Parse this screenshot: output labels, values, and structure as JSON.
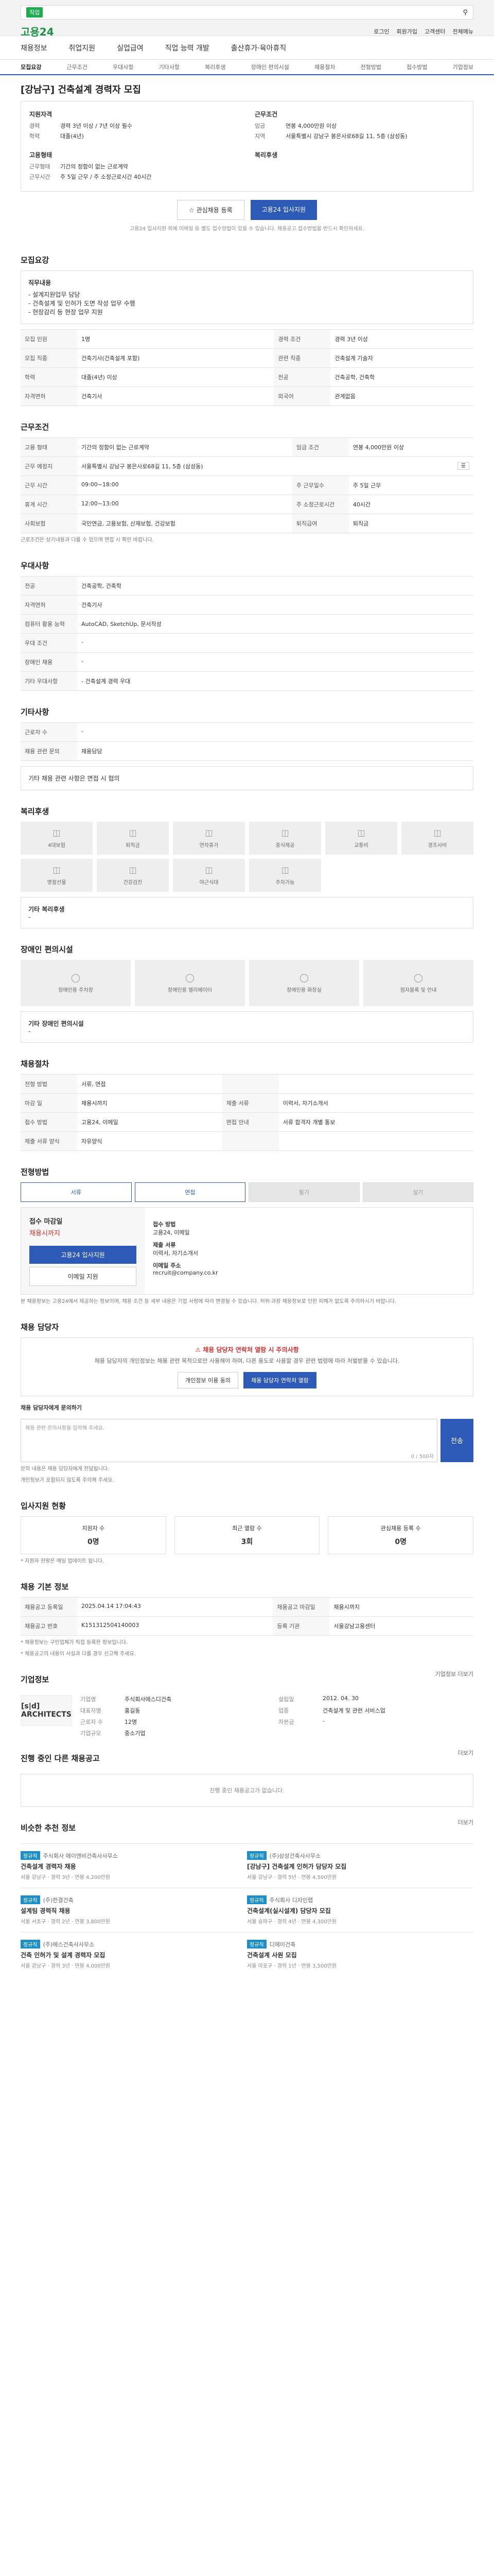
{
  "search": {
    "chip": "직업",
    "placeholder": ""
  },
  "header": {
    "logo": "고용24",
    "links": [
      "로그인",
      "회원가입",
      "고객센터",
      "전체메뉴"
    ]
  },
  "nav": {
    "items": [
      "채용정보",
      "취업지원",
      "실업급여",
      "직업 능력 개발",
      "출산휴가·육아휴직"
    ]
  },
  "tabs": [
    "모집요강",
    "근무조건",
    "우대사항",
    "기타사항",
    "복리후생",
    "장애인 편의시설",
    "채용절차",
    "전형방법",
    "접수방법",
    "기업정보"
  ],
  "job": {
    "title": "[강남구] 건축설계 경력자 모집",
    "summary": {
      "req_h": "지원자격",
      "req": [
        {
          "k": "경력",
          "v": "경력 3년 이상 / 7년 이상 필수"
        },
        {
          "k": "학력",
          "v": "대졸(4년)"
        }
      ],
      "cond_h": "근무조건",
      "cond": [
        {
          "k": "임금",
          "v": "연봉 4,000만원 이상"
        },
        {
          "k": "지역",
          "v": "서울특별시 강남구 봉은사로68길 11, 5층 (삼성동)"
        }
      ],
      "type_h": "고용형태",
      "type": [
        {
          "k": "근무형태",
          "v": "기간의 정함이 없는 근로계약"
        },
        {
          "k": "근무시간",
          "v": "주 5일 근무 / 주 소정근로시간 40시간"
        }
      ],
      "welfare_h": "복리후생",
      "welfare": []
    },
    "actions": {
      "save": "관심채용 등록",
      "apply": "고용24 입사지원"
    },
    "note": "고용24 입사지원 외에 이메일 등 별도 접수방법이 있을 수 있습니다. 채용공고 접수방법을 반드시 확인하세요."
  },
  "recruit": {
    "title": "모집요강",
    "duty_h": "직무내용",
    "duty": [
      "- 설계지원업무 담당",
      "- 건축설계 및 인허가 도면 작성 업무 수행",
      "- 현장감리 등 현장 업무 지원"
    ],
    "rows": [
      {
        "k": "모집 인원",
        "v": "1명",
        "k2": "경력 조건",
        "v2": "경력 3년 이상"
      },
      {
        "k": "모집 직종",
        "v": "건축기사(건축설계 포함)",
        "k2": "관련 직종",
        "v2": "건축설계 기술자"
      },
      {
        "k": "학력",
        "v": "대졸(4년) 이상",
        "k2": "전공",
        "v2": "건축공학, 건축학"
      },
      {
        "k": "자격면허",
        "v": "건축기사",
        "k2": "외국어",
        "v2": "관계없음"
      }
    ]
  },
  "work": {
    "title": "근무조건",
    "rows": [
      {
        "k": "고용 형태",
        "v": "기간의 정함이 없는 근로계약",
        "k2": "임금 조건",
        "v2": "연봉 4,000만원 이상"
      },
      {
        "k": "근무 예정지",
        "v": "서울특별시 강남구 봉은사로68길 11, 5층 (삼성동)"
      },
      {
        "k": "근무 시간",
        "v": "09:00~18:00",
        "k2": "주 근무일수",
        "v2": "주 5일 근무"
      },
      {
        "k": "휴게 시간",
        "v": "12:00~13:00",
        "k2": "주 소정근로시간",
        "v2": "40시간"
      },
      {
        "k": "사회보험",
        "v": "국민연금, 고용보험, 산재보험, 건강보험",
        "k2": "퇴직급여",
        "v2": "퇴직금"
      }
    ],
    "note": "근로조건은 상기내용과 다를 수 있으며 면접 시 확인 바랍니다."
  },
  "prefer": {
    "title": "우대사항",
    "rows": [
      {
        "k": "전공",
        "v": "건축공학, 건축학"
      },
      {
        "k": "자격면허",
        "v": "건축기사"
      },
      {
        "k": "컴퓨터 활용 능력",
        "v": "AutoCAD, SketchUp, 문서작성"
      },
      {
        "k": "우대 조건",
        "v": "-"
      },
      {
        "k": "장애인 채용",
        "v": "-"
      },
      {
        "k": "기타 우대사항",
        "v": "- 건축설계 경력 우대"
      }
    ]
  },
  "etc": {
    "title": "기타사항",
    "rows": [
      {
        "k": "근로자 수",
        "v": "-"
      },
      {
        "k": "채용 관련 문의",
        "v": "채용담당"
      }
    ],
    "detail": "기타 채용 관련 사항은 면접 시 협의"
  },
  "welfare": {
    "title": "복리후생",
    "tiles": [
      "4대보험",
      "퇴직금",
      "연차휴가",
      "중식제공",
      "교통비",
      "경조사비",
      "명절선물",
      "건강검진",
      "야근식대",
      "주차가능"
    ],
    "note_title": "기타 복리후생",
    "note": "-"
  },
  "facility": {
    "title": "장애인 편의시설",
    "tiles": [
      "장애인용 주차장",
      "장애인용 엘리베이터",
      "장애인용 화장실",
      "점자블록 및 안내"
    ],
    "note_title": "기타 장애인 편의시설",
    "note": "-"
  },
  "process": {
    "title": "채용절차",
    "rows": [
      {
        "k": "전형 방법",
        "v": "서류, 면접",
        "k2": "",
        "v2": ""
      },
      {
        "k": "마감 일",
        "v": "채용시까지",
        "k2": "제출 서류",
        "v2": "이력서, 자기소개서"
      },
      {
        "k": "접수 방법",
        "v": "고용24, 이메일",
        "k2": "면접 안내",
        "v2": "서류 합격자 개별 통보"
      },
      {
        "k": "제출 서류 양식",
        "v": "자유양식",
        "k2": "",
        "v2": ""
      }
    ]
  },
  "screening": {
    "title": "전형방법",
    "chips": [
      "서류",
      "면접",
      "필기",
      "실기"
    ]
  },
  "apply": {
    "title_left": "접수 마감일",
    "deadline": "채용시까지",
    "remain_label": "남은 기간",
    "button": "고용24 입사지원",
    "button2": "이메일 지원",
    "method_lbl": "접수 방법",
    "method": "고용24, 이메일",
    "doc_lbl": "제출 서류",
    "docs": "이력서, 자기소개서",
    "email_lbl": "이메일 주소",
    "email": "recruit@company.co.kr",
    "notice": "본 채용정보는 고용24에서 제공하는 정보이며, 채용 조건 등 세부 내용은 기업 사정에 따라 변경될 수 있습니다. 허위·과장 채용정보로 인한 피해가 없도록 주의하시기 바랍니다."
  },
  "inquiry": {
    "title": "채용 담당자",
    "warn": "채용 담당자 연락처 열람 시 주의사항",
    "text": "채용 담당자의 개인정보는 채용 관련 목적으로만 사용해야 하며, 다른 용도로 사용할 경우 관련 법령에 따라 처벌받을 수 있습니다.",
    "btns": [
      "개인정보 이용 동의",
      "채용 담당자 연락처 열람"
    ],
    "form_label": "채용 담당자에게 문의하기",
    "placeholder": "채용 관련 문의사항을 입력해 주세요.",
    "count": "0 / 500자",
    "send": "전송",
    "notes": [
      "문의 내용은 채용 담당자에게 전달됩니다.",
      "개인정보가 포함되지 않도록 주의해 주세요."
    ]
  },
  "stats": {
    "title": "입사지원 현황",
    "items": [
      {
        "label": "지원자 수",
        "n": "0명"
      },
      {
        "label": "최근 열람 수",
        "n": "3회"
      },
      {
        "label": "관심채용 등록 수",
        "n": "0명"
      }
    ],
    "note": "* 지원자 현황은 매일 업데이트 됩니다."
  },
  "info": {
    "title": "채용 기본 정보",
    "rows": [
      {
        "k": "채용공고 등록일",
        "v": "2025.04.14 17:04:43",
        "k2": "채용공고 마감일",
        "v2": "채용시까지"
      },
      {
        "k": "채용공고 번호",
        "v": "K151312504140003",
        "k2": "등록 기관",
        "v2": "서울강남고용센터"
      }
    ],
    "notes": [
      "* 채용정보는 구인업체가 직접 등록한 정보입니다.",
      "* 채용공고의 내용이 사실과 다를 경우 신고해 주세요."
    ]
  },
  "company": {
    "title": "기업정보",
    "logo": "[s|d] ARCHITECTS",
    "rows": [
      {
        "k": "기업명",
        "v": "주식회사에스디건축",
        "k2": "설립일",
        "v2": "2012. 04. 30"
      },
      {
        "k": "대표자명",
        "v": "홍길동",
        "k2": "업종",
        "v2": "건축설계 및 관련 서비스업"
      },
      {
        "k": "근로자 수",
        "v": "12명",
        "k2": "자본금",
        "v2": "-"
      },
      {
        "k": "기업규모",
        "v": "중소기업",
        "k2": "",
        "v2": ""
      }
    ],
    "more": "기업정보 더보기"
  },
  "ongoing": {
    "title": "진행 중인 다른 채용공고",
    "more": "더보기",
    "empty": "진행 중인 채용공고가 없습니다."
  },
  "recommend": {
    "title": "비슷한 추천 정보",
    "more": "더보기",
    "items": [
      {
        "tag": "정규직",
        "co": "주식회사 에이앤비건축사사무소",
        "title": "건축설계 경력자 채용",
        "meta": "서울 강남구 · 경력 3년 · 연봉 4,200만원"
      },
      {
        "tag": "정규직",
        "co": "(주)삼성건축사사무소",
        "title": "[강남구] 건축설계 인허가 담당자 모집",
        "meta": "서울 강남구 · 경력 5년 · 연봉 4,500만원"
      },
      {
        "tag": "정규직",
        "co": "(주)한결건축",
        "title": "설계팀 경력직 채용",
        "meta": "서울 서초구 · 경력 2년 · 연봉 3,800만원"
      },
      {
        "tag": "정규직",
        "co": "주식회사 디자인랩",
        "title": "건축설계(실시설계) 담당자 모집",
        "meta": "서울 송파구 · 경력 4년 · 연봉 4,300만원"
      },
      {
        "tag": "정규직",
        "co": "(주)에스건축사사무소",
        "title": "건축 인허가 및 설계 경력자 모집",
        "meta": "서울 강남구 · 경력 3년 · 연봉 4,000만원"
      },
      {
        "tag": "정규직",
        "co": "디에이건축",
        "title": "건축설계 사원 모집",
        "meta": "서울 마포구 · 경력 1년 · 연봉 3,500만원"
      }
    ]
  }
}
